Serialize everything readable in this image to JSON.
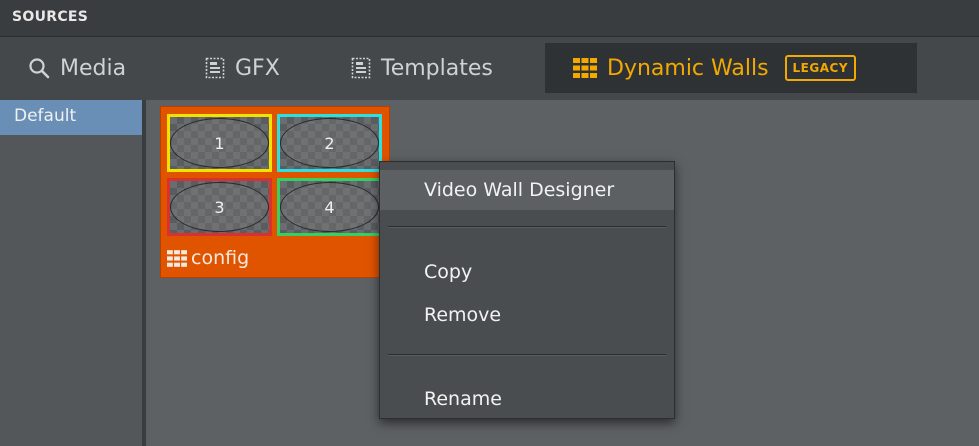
{
  "panel": {
    "title": "SOURCES"
  },
  "tabs": [
    {
      "label": "Media",
      "icon": "search-icon"
    },
    {
      "label": "GFX",
      "icon": "template-icon"
    },
    {
      "label": "Templates",
      "icon": "template-icon"
    },
    {
      "label": "Dynamic Walls",
      "icon": "grid-icon",
      "badge": "LEGACY",
      "active": true
    }
  ],
  "sidebar": {
    "items": [
      {
        "label": "Default",
        "selected": true
      }
    ]
  },
  "tile": {
    "label": "config",
    "cells": [
      "1",
      "2",
      "3",
      "4"
    ]
  },
  "context_menu": {
    "items": [
      {
        "label": "Video Wall Designer"
      },
      {
        "label": "Copy"
      },
      {
        "label": "Remove"
      },
      {
        "label": "Rename"
      }
    ]
  },
  "colors": {
    "accent": "#f2a900",
    "tile_bg": "#e05400",
    "cell_1": "#f4e300",
    "cell_2": "#2de0e0",
    "cell_3": "#d93030",
    "cell_4": "#35d060",
    "sidebar_selected": "#6a8fb6"
  }
}
